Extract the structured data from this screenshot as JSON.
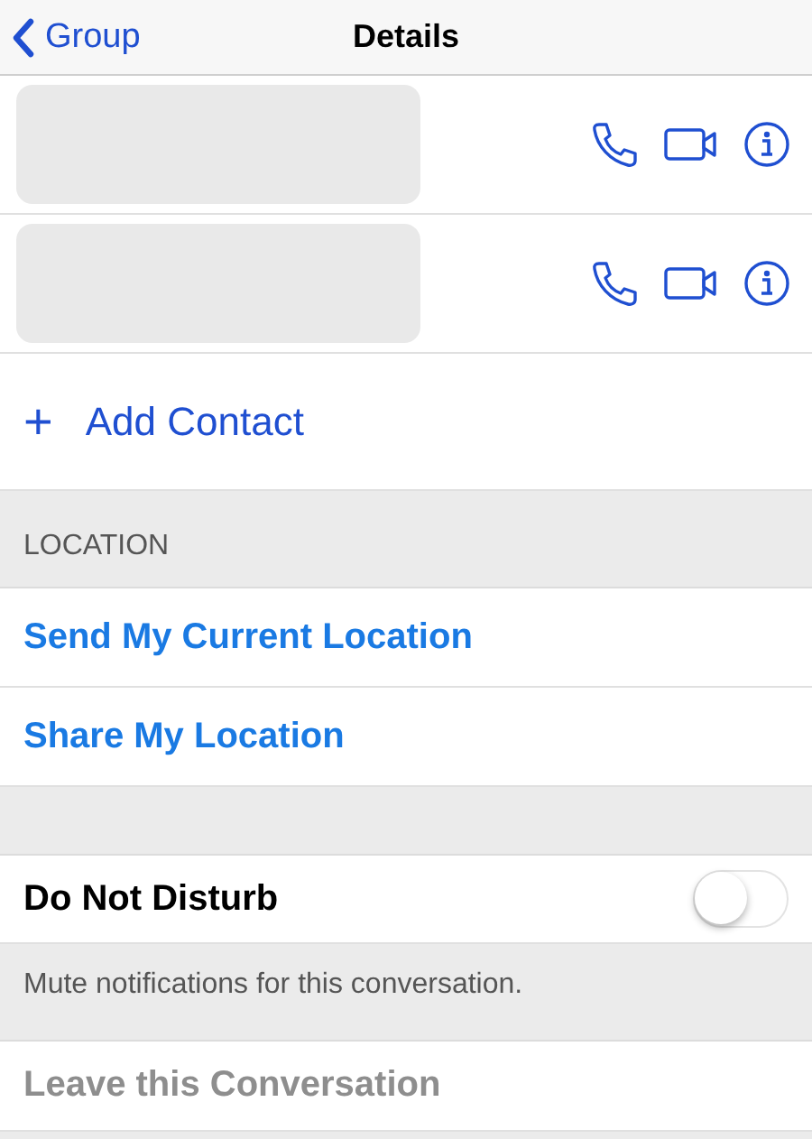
{
  "nav": {
    "back_label": "Group",
    "title": "Details"
  },
  "contacts": [
    {
      "kind": "redacted"
    },
    {
      "kind": "redacted"
    }
  ],
  "add_contact": {
    "icon": "+",
    "label": "Add Contact"
  },
  "location": {
    "header": "LOCATION",
    "actions": [
      "Send My Current Location",
      "Share My Location"
    ]
  },
  "do_not_disturb": {
    "label": "Do Not Disturb",
    "on": false,
    "footer": "Mute notifications for this conversation."
  },
  "leave": {
    "label": "Leave this Conversation",
    "disabled": true
  }
}
